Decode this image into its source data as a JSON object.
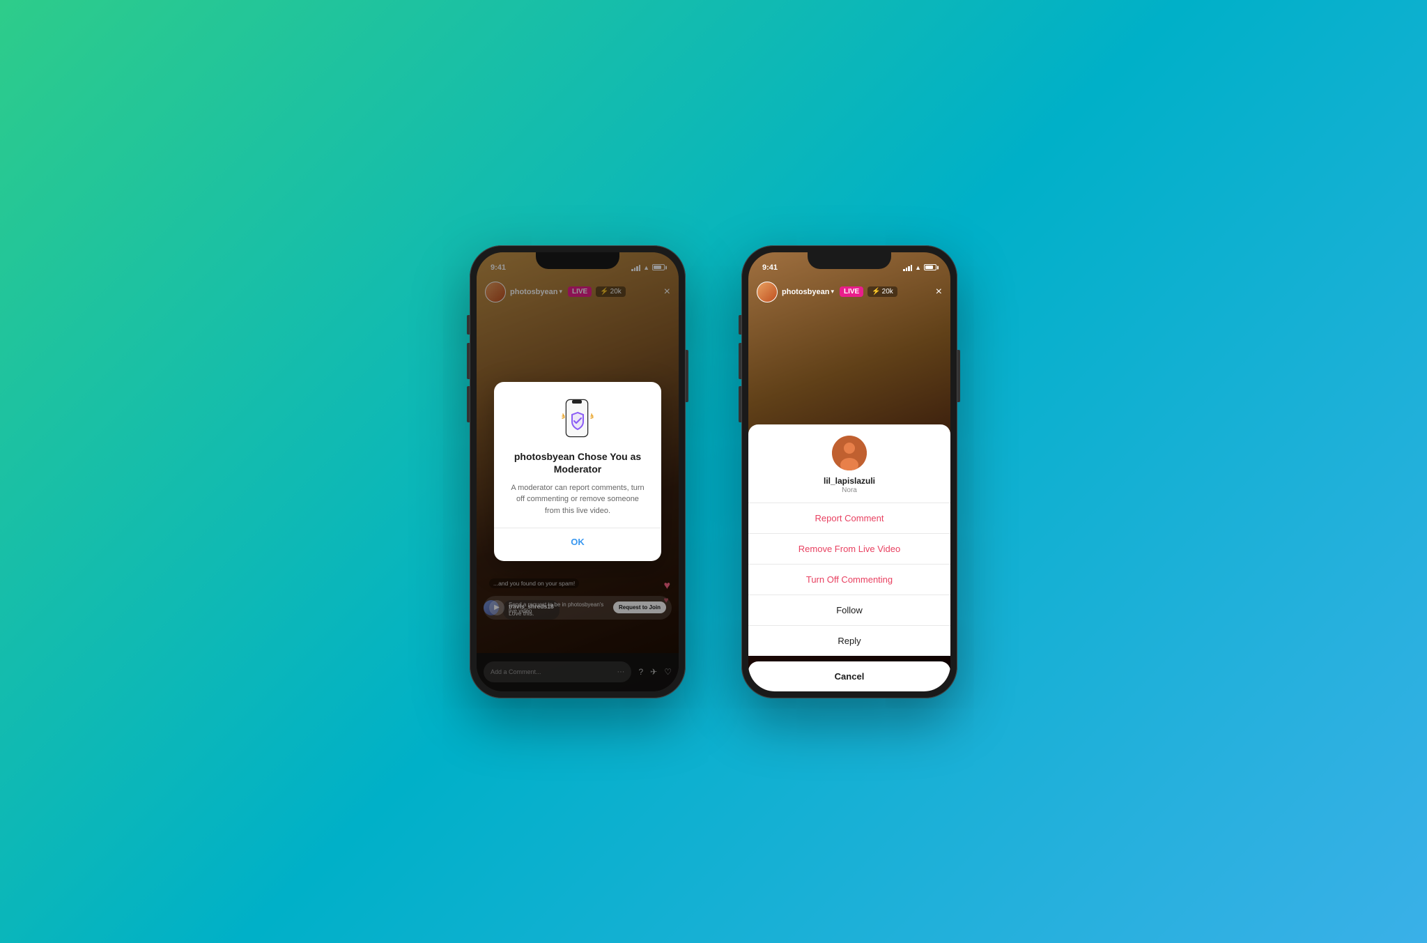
{
  "background": {
    "gradient_start": "#2ecc8a",
    "gradient_mid": "#00b0c8",
    "gradient_end": "#3ab0e8"
  },
  "phone1": {
    "status_bar": {
      "time": "9:41",
      "battery": "80"
    },
    "header": {
      "username": "photosbyean",
      "live_label": "LIVE",
      "viewers": "20k",
      "close": "×"
    },
    "modal": {
      "title": "photosbyean Chose You as Moderator",
      "body": "A moderator can report comments, turn off commenting or remove someone from this live video.",
      "ok_label": "OK"
    },
    "comments": [
      {
        "user": "travis_shreds18",
        "text": "Love this."
      }
    ],
    "request_bar": {
      "text": "Send a request to be in photosbyean's live video",
      "button": "Request to Join"
    },
    "comment_input": {
      "placeholder": "Add a Comment..."
    }
  },
  "phone2": {
    "status_bar": {
      "time": "9:41",
      "battery": "80"
    },
    "header": {
      "username": "photosbyean",
      "live_label": "LIVE",
      "viewers": "20k",
      "close": "×"
    },
    "action_sheet": {
      "user": {
        "username": "lil_lapislazuli",
        "real_name": "Nora"
      },
      "items": [
        {
          "label": "Report Comment",
          "style": "red"
        },
        {
          "label": "Remove From Live Video",
          "style": "red"
        },
        {
          "label": "Turn Off Commenting",
          "style": "red"
        },
        {
          "label": "Follow",
          "style": "black"
        },
        {
          "label": "Reply",
          "style": "black"
        }
      ],
      "cancel_label": "Cancel"
    }
  }
}
